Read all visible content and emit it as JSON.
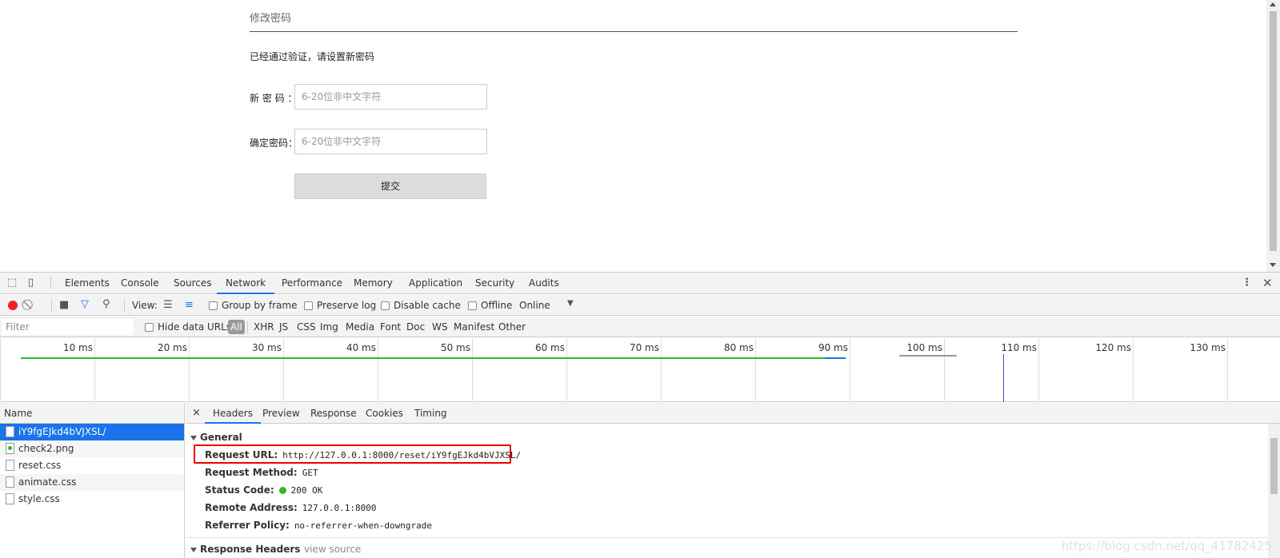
{
  "page": {
    "title": "修改密码",
    "description": "已经通过验证，请设置新密码",
    "new_password_label": "新 密 码 ：",
    "confirm_password_label": "确定密码：",
    "new_password_placeholder": "6-20位非中文字符",
    "confirm_password_placeholder": "6-20位非中文字符",
    "submit_label": "提交"
  },
  "devtools": {
    "tabs": [
      "Elements",
      "Console",
      "Sources",
      "Network",
      "Performance",
      "Memory",
      "Application",
      "Security",
      "Audits"
    ],
    "active_tab": "Network",
    "toolbar": {
      "view_label": "View:",
      "group_by_frame": "Group by frame",
      "preserve_log": "Preserve log",
      "disable_cache": "Disable cache",
      "offline": "Offline",
      "throttle": "Online"
    },
    "filter": {
      "placeholder": "Filter",
      "hide_data_urls": "Hide data URLs",
      "types": [
        "All",
        "XHR",
        "JS",
        "CSS",
        "Img",
        "Media",
        "Font",
        "Doc",
        "WS",
        "Manifest",
        "Other"
      ]
    },
    "timeline_labels": [
      "10 ms",
      "20 ms",
      "30 ms",
      "40 ms",
      "50 ms",
      "60 ms",
      "70 ms",
      "80 ms",
      "90 ms",
      "100 ms",
      "110 ms",
      "120 ms",
      "130 ms"
    ],
    "name_header": "Name",
    "requests": [
      "iY9fgEJkd4bVJXSL/",
      "check2.png",
      "reset.css",
      "animate.css",
      "style.css"
    ],
    "detail_tabs": [
      "Headers",
      "Preview",
      "Response",
      "Cookies",
      "Timing"
    ],
    "general": {
      "heading": "General",
      "request_url_key": "Request URL:",
      "request_url": "http://127.0.0.1:8000/reset/iY9fgEJkd4bVJXSL/",
      "method_key": "Request Method:",
      "method": "GET",
      "status_key": "Status Code:",
      "status": "200 OK",
      "remote_key": "Remote Address:",
      "remote": "127.0.0.1:8000",
      "referrer_key": "Referrer Policy:",
      "referrer": "no-referrer-when-downgrade"
    },
    "response_headers": {
      "heading": "Response Headers",
      "view_source": "view source"
    }
  },
  "watermark": "https://blog.csdn.net/qq_41782425",
  "colors": {
    "accent": "#1a73e8",
    "record": "#ee2222",
    "status_ok": "#2eb82e",
    "highlight": "#ee0000"
  }
}
